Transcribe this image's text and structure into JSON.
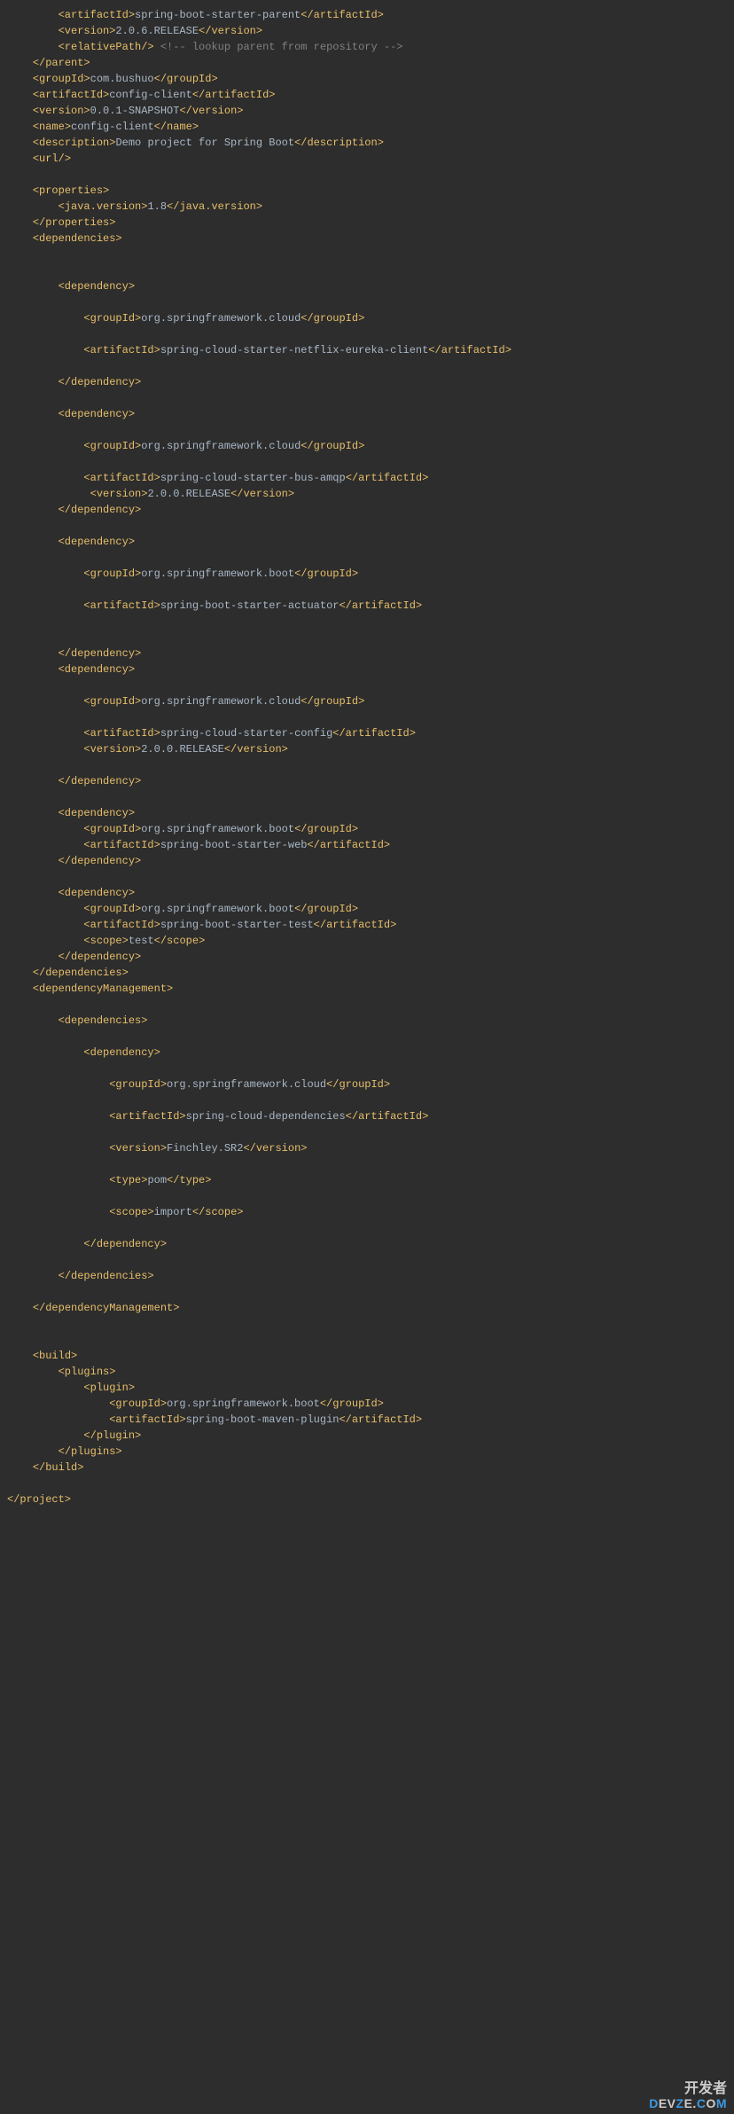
{
  "code": {
    "lines": [
      {
        "indent": 8,
        "parts": [
          {
            "t": "tag",
            "v": "<artifactId>"
          },
          {
            "t": "text",
            "v": "spring-boot-starter-parent"
          },
          {
            "t": "tag",
            "v": "</artifactId>"
          }
        ]
      },
      {
        "indent": 8,
        "parts": [
          {
            "t": "tag",
            "v": "<version>"
          },
          {
            "t": "text",
            "v": "2.0.6.RELEASE"
          },
          {
            "t": "tag",
            "v": "</version>"
          }
        ]
      },
      {
        "indent": 8,
        "parts": [
          {
            "t": "tag",
            "v": "<relativePath/>"
          },
          {
            "t": "text",
            "v": " "
          },
          {
            "t": "comment",
            "v": "<!-- lookup parent from repository -->"
          }
        ]
      },
      {
        "indent": 4,
        "parts": [
          {
            "t": "tag",
            "v": "</parent>"
          }
        ]
      },
      {
        "indent": 4,
        "parts": [
          {
            "t": "tag",
            "v": "<groupId>"
          },
          {
            "t": "text",
            "v": "com.bushuo"
          },
          {
            "t": "tag",
            "v": "</groupId>"
          }
        ]
      },
      {
        "indent": 4,
        "parts": [
          {
            "t": "tag",
            "v": "<artifactId>"
          },
          {
            "t": "text",
            "v": "config-client"
          },
          {
            "t": "tag",
            "v": "</artifactId>"
          }
        ]
      },
      {
        "indent": 4,
        "parts": [
          {
            "t": "tag",
            "v": "<version>"
          },
          {
            "t": "text",
            "v": "0.0.1-SNAPSHOT"
          },
          {
            "t": "tag",
            "v": "</version>"
          }
        ]
      },
      {
        "indent": 4,
        "parts": [
          {
            "t": "tag",
            "v": "<name>"
          },
          {
            "t": "text",
            "v": "config-client"
          },
          {
            "t": "tag",
            "v": "</name>"
          }
        ]
      },
      {
        "indent": 4,
        "parts": [
          {
            "t": "tag",
            "v": "<description>"
          },
          {
            "t": "text",
            "v": "Demo project for Spring Boot"
          },
          {
            "t": "tag",
            "v": "</description>"
          }
        ]
      },
      {
        "indent": 4,
        "parts": [
          {
            "t": "tag",
            "v": "<url/>"
          }
        ]
      },
      {
        "indent": 0,
        "parts": []
      },
      {
        "indent": 4,
        "parts": [
          {
            "t": "tag",
            "v": "<properties>"
          }
        ]
      },
      {
        "indent": 8,
        "parts": [
          {
            "t": "tag",
            "v": "<java.version>"
          },
          {
            "t": "text",
            "v": "1.8"
          },
          {
            "t": "tag",
            "v": "</java.version>"
          }
        ]
      },
      {
        "indent": 4,
        "parts": [
          {
            "t": "tag",
            "v": "</properties>"
          }
        ]
      },
      {
        "indent": 4,
        "parts": [
          {
            "t": "tag",
            "v": "<dependencies>"
          }
        ]
      },
      {
        "indent": 0,
        "parts": []
      },
      {
        "indent": 0,
        "parts": []
      },
      {
        "indent": 8,
        "parts": [
          {
            "t": "tag",
            "v": "<dependency>"
          }
        ]
      },
      {
        "indent": 0,
        "parts": []
      },
      {
        "indent": 12,
        "parts": [
          {
            "t": "tag",
            "v": "<groupId>"
          },
          {
            "t": "text",
            "v": "org.springframework.cloud"
          },
          {
            "t": "tag",
            "v": "</groupId>"
          }
        ]
      },
      {
        "indent": 0,
        "parts": []
      },
      {
        "indent": 12,
        "parts": [
          {
            "t": "tag",
            "v": "<artifactId>"
          },
          {
            "t": "text",
            "v": "spring-cloud-starter-netflix-eureka-client"
          },
          {
            "t": "tag",
            "v": "</artifactId>"
          }
        ]
      },
      {
        "indent": 0,
        "parts": []
      },
      {
        "indent": 8,
        "parts": [
          {
            "t": "tag",
            "v": "</dependency>"
          }
        ]
      },
      {
        "indent": 0,
        "parts": []
      },
      {
        "indent": 8,
        "parts": [
          {
            "t": "tag",
            "v": "<dependency>"
          }
        ]
      },
      {
        "indent": 0,
        "parts": []
      },
      {
        "indent": 12,
        "parts": [
          {
            "t": "tag",
            "v": "<groupId>"
          },
          {
            "t": "text",
            "v": "org.springframework.cloud"
          },
          {
            "t": "tag",
            "v": "</groupId>"
          }
        ]
      },
      {
        "indent": 0,
        "parts": []
      },
      {
        "indent": 12,
        "parts": [
          {
            "t": "tag",
            "v": "<artifactId>"
          },
          {
            "t": "text",
            "v": "spring-cloud-starter-bus-amqp"
          },
          {
            "t": "tag",
            "v": "</artifactId>"
          }
        ]
      },
      {
        "indent": 13,
        "parts": [
          {
            "t": "tag",
            "v": "<version>"
          },
          {
            "t": "text",
            "v": "2.0.0.RELEASE"
          },
          {
            "t": "tag",
            "v": "</version>"
          }
        ]
      },
      {
        "indent": 8,
        "parts": [
          {
            "t": "tag",
            "v": "</dependency>"
          }
        ]
      },
      {
        "indent": 0,
        "parts": []
      },
      {
        "indent": 8,
        "parts": [
          {
            "t": "tag",
            "v": "<dependency>"
          }
        ]
      },
      {
        "indent": 0,
        "parts": []
      },
      {
        "indent": 12,
        "parts": [
          {
            "t": "tag",
            "v": "<groupId>"
          },
          {
            "t": "text",
            "v": "org.springframework.boot"
          },
          {
            "t": "tag",
            "v": "</groupId>"
          }
        ]
      },
      {
        "indent": 0,
        "parts": []
      },
      {
        "indent": 12,
        "parts": [
          {
            "t": "tag",
            "v": "<artifactId>"
          },
          {
            "t": "text",
            "v": "spring-boot-starter-actuator"
          },
          {
            "t": "tag",
            "v": "</artifactId>"
          }
        ]
      },
      {
        "indent": 0,
        "parts": []
      },
      {
        "indent": 0,
        "parts": []
      },
      {
        "indent": 8,
        "parts": [
          {
            "t": "tag",
            "v": "</dependency>"
          }
        ]
      },
      {
        "indent": 8,
        "parts": [
          {
            "t": "tag",
            "v": "<dependency>"
          }
        ]
      },
      {
        "indent": 0,
        "parts": []
      },
      {
        "indent": 12,
        "parts": [
          {
            "t": "tag",
            "v": "<groupId>"
          },
          {
            "t": "text",
            "v": "org.springframework.cloud"
          },
          {
            "t": "tag",
            "v": "</groupId>"
          }
        ]
      },
      {
        "indent": 0,
        "parts": []
      },
      {
        "indent": 12,
        "parts": [
          {
            "t": "tag",
            "v": "<artifactId>"
          },
          {
            "t": "text",
            "v": "spring-cloud-starter-config"
          },
          {
            "t": "tag",
            "v": "</artifactId>"
          }
        ]
      },
      {
        "indent": 12,
        "parts": [
          {
            "t": "tag",
            "v": "<version>"
          },
          {
            "t": "text",
            "v": "2.0.0.RELEASE"
          },
          {
            "t": "tag",
            "v": "</version>"
          }
        ]
      },
      {
        "indent": 0,
        "parts": []
      },
      {
        "indent": 8,
        "parts": [
          {
            "t": "tag",
            "v": "</dependency>"
          }
        ]
      },
      {
        "indent": 0,
        "parts": []
      },
      {
        "indent": 8,
        "parts": [
          {
            "t": "tag",
            "v": "<dependency>"
          }
        ]
      },
      {
        "indent": 12,
        "parts": [
          {
            "t": "tag",
            "v": "<groupId>"
          },
          {
            "t": "text",
            "v": "org.springframework.boot"
          },
          {
            "t": "tag",
            "v": "</groupId>"
          }
        ]
      },
      {
        "indent": 12,
        "parts": [
          {
            "t": "tag",
            "v": "<artifactId>"
          },
          {
            "t": "text",
            "v": "spring-boot-starter-web"
          },
          {
            "t": "tag",
            "v": "</artifactId>"
          }
        ]
      },
      {
        "indent": 8,
        "parts": [
          {
            "t": "tag",
            "v": "</dependency>"
          }
        ]
      },
      {
        "indent": 0,
        "parts": []
      },
      {
        "indent": 8,
        "parts": [
          {
            "t": "tag",
            "v": "<dependency>"
          }
        ]
      },
      {
        "indent": 12,
        "parts": [
          {
            "t": "tag",
            "v": "<groupId>"
          },
          {
            "t": "text",
            "v": "org.springframework.boot"
          },
          {
            "t": "tag",
            "v": "</groupId>"
          }
        ]
      },
      {
        "indent": 12,
        "parts": [
          {
            "t": "tag",
            "v": "<artifactId>"
          },
          {
            "t": "text",
            "v": "spring-boot-starter-test"
          },
          {
            "t": "tag",
            "v": "</artifactId>"
          }
        ]
      },
      {
        "indent": 12,
        "parts": [
          {
            "t": "tag",
            "v": "<scope>"
          },
          {
            "t": "text",
            "v": "test"
          },
          {
            "t": "tag",
            "v": "</scope>"
          }
        ]
      },
      {
        "indent": 8,
        "parts": [
          {
            "t": "tag",
            "v": "</dependency>"
          }
        ]
      },
      {
        "indent": 4,
        "parts": [
          {
            "t": "tag",
            "v": "</dependencies>"
          }
        ]
      },
      {
        "indent": 4,
        "parts": [
          {
            "t": "tag",
            "v": "<dependencyManagement>"
          }
        ]
      },
      {
        "indent": 0,
        "parts": []
      },
      {
        "indent": 8,
        "parts": [
          {
            "t": "tag",
            "v": "<dependencies>"
          }
        ]
      },
      {
        "indent": 0,
        "parts": []
      },
      {
        "indent": 12,
        "parts": [
          {
            "t": "tag",
            "v": "<dependency>"
          }
        ]
      },
      {
        "indent": 0,
        "parts": []
      },
      {
        "indent": 16,
        "parts": [
          {
            "t": "tag",
            "v": "<groupId>"
          },
          {
            "t": "text",
            "v": "org.springframework.cloud"
          },
          {
            "t": "tag",
            "v": "</groupId>"
          }
        ]
      },
      {
        "indent": 0,
        "parts": []
      },
      {
        "indent": 16,
        "parts": [
          {
            "t": "tag",
            "v": "<artifactId>"
          },
          {
            "t": "text",
            "v": "spring-cloud-dependencies"
          },
          {
            "t": "tag",
            "v": "</artifactId>"
          }
        ]
      },
      {
        "indent": 0,
        "parts": []
      },
      {
        "indent": 16,
        "parts": [
          {
            "t": "tag",
            "v": "<version>"
          },
          {
            "t": "text",
            "v": "Finchley.SR2"
          },
          {
            "t": "tag",
            "v": "</version>"
          }
        ]
      },
      {
        "indent": 0,
        "parts": []
      },
      {
        "indent": 16,
        "parts": [
          {
            "t": "tag",
            "v": "<type>"
          },
          {
            "t": "text",
            "v": "pom"
          },
          {
            "t": "tag",
            "v": "</type>"
          }
        ]
      },
      {
        "indent": 0,
        "parts": []
      },
      {
        "indent": 16,
        "parts": [
          {
            "t": "tag",
            "v": "<scope>"
          },
          {
            "t": "text",
            "v": "import"
          },
          {
            "t": "tag",
            "v": "</scope>"
          }
        ]
      },
      {
        "indent": 0,
        "parts": []
      },
      {
        "indent": 12,
        "parts": [
          {
            "t": "tag",
            "v": "</dependency>"
          }
        ]
      },
      {
        "indent": 0,
        "parts": []
      },
      {
        "indent": 8,
        "parts": [
          {
            "t": "tag",
            "v": "</dependencies>"
          }
        ]
      },
      {
        "indent": 0,
        "parts": []
      },
      {
        "indent": 4,
        "parts": [
          {
            "t": "tag",
            "v": "</dependencyManagement>"
          }
        ]
      },
      {
        "indent": 0,
        "parts": []
      },
      {
        "indent": 0,
        "parts": []
      },
      {
        "indent": 4,
        "parts": [
          {
            "t": "tag",
            "v": "<build>"
          }
        ]
      },
      {
        "indent": 8,
        "parts": [
          {
            "t": "tag",
            "v": "<plugins>"
          }
        ]
      },
      {
        "indent": 12,
        "parts": [
          {
            "t": "tag",
            "v": "<plugin>"
          }
        ]
      },
      {
        "indent": 16,
        "parts": [
          {
            "t": "tag",
            "v": "<groupId>"
          },
          {
            "t": "text",
            "v": "org.springframework.boot"
          },
          {
            "t": "tag",
            "v": "</groupId>"
          }
        ]
      },
      {
        "indent": 16,
        "parts": [
          {
            "t": "tag",
            "v": "<artifactId>"
          },
          {
            "t": "text",
            "v": "spring-boot-maven-plugin"
          },
          {
            "t": "tag",
            "v": "</artifactId>"
          }
        ]
      },
      {
        "indent": 12,
        "parts": [
          {
            "t": "tag",
            "v": "</plugin>"
          }
        ]
      },
      {
        "indent": 8,
        "parts": [
          {
            "t": "tag",
            "v": "</plugins>"
          }
        ]
      },
      {
        "indent": 4,
        "parts": [
          {
            "t": "tag",
            "v": "</build>"
          }
        ]
      },
      {
        "indent": 0,
        "parts": []
      },
      {
        "indent": 0,
        "parts": [
          {
            "t": "tag",
            "v": "</project>"
          }
        ]
      }
    ]
  },
  "watermark": {
    "cn": "开发者",
    "en_prefix1": "D",
    "en_mid1": "EV",
    "en_prefix2": "Z",
    "en_mid2": "E.",
    "en_prefix3": "C",
    "en_mid3": "O",
    "en_prefix4": "M",
    "en_full": "DevZe.CoM"
  }
}
